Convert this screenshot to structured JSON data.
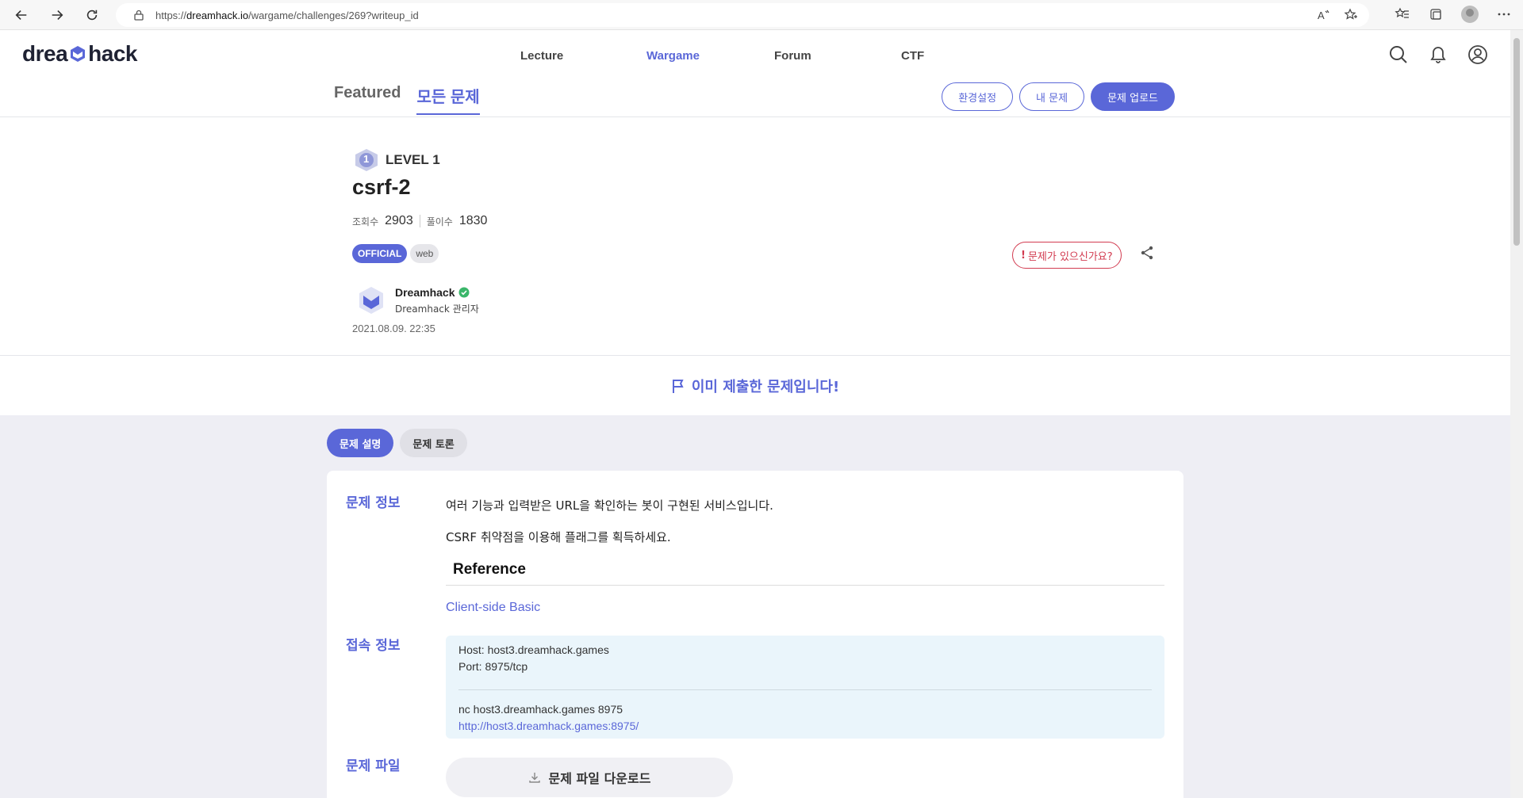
{
  "browser": {
    "url_prefix": "https://",
    "url_domain": "dreamhack.io",
    "url_path": "/wargame/challenges/269?writeup_id"
  },
  "header": {
    "logo_left": "drea",
    "logo_right": "hack",
    "nav": [
      {
        "label": "Lecture"
      },
      {
        "label": "Wargame"
      },
      {
        "label": "Forum"
      },
      {
        "label": "CTF"
      }
    ],
    "active_nav": "Wargame",
    "sub_tabs": [
      {
        "label": "Featured"
      },
      {
        "label": "모든 문제"
      }
    ],
    "actions": {
      "settings": "환경설정",
      "my_problems": "내 문제",
      "upload": "문제 업로드"
    }
  },
  "challenge": {
    "level_num": "1",
    "level_label": "LEVEL 1",
    "title": "csrf-2",
    "views_label": "조회수",
    "views": "2903",
    "solves_label": "풀이수",
    "solves": "1830",
    "tags": [
      "OFFICIAL",
      "web"
    ],
    "report_label": "문제가 있으신가요?",
    "report_mark": "!",
    "author_name": "Dreamhack",
    "author_role": "Dreamhack 관리자",
    "date": "2021.08.09. 22:35"
  },
  "submitted_banner": "이미 제출한 문제입니다!",
  "content_tabs": {
    "description": "문제 설명",
    "discussion": "문제 토론"
  },
  "sections": {
    "info_label": "문제 정보",
    "info_line1": "여러 기능과 입력받은 URL을 확인하는 봇이 구현된 서비스입니다.",
    "info_line2": "CSRF 취약점을 이용해 플래그를 획득하세요.",
    "reference_title": "Reference",
    "reference_link": "Client-side Basic",
    "conn_label": "접속 정보",
    "conn_host": "Host: host3.dreamhack.games",
    "conn_port": "Port: 8975/tcp",
    "conn_nc": "nc host3.dreamhack.games 8975",
    "conn_url": "http://host3.dreamhack.games:8975/",
    "file_label": "문제 파일",
    "download_label": "문제 파일 다운로드"
  },
  "colors": {
    "accent": "#5a67d8",
    "danger": "#d23b50",
    "content_bg": "#eeeef4",
    "conn_bg": "#eaf5fb"
  }
}
